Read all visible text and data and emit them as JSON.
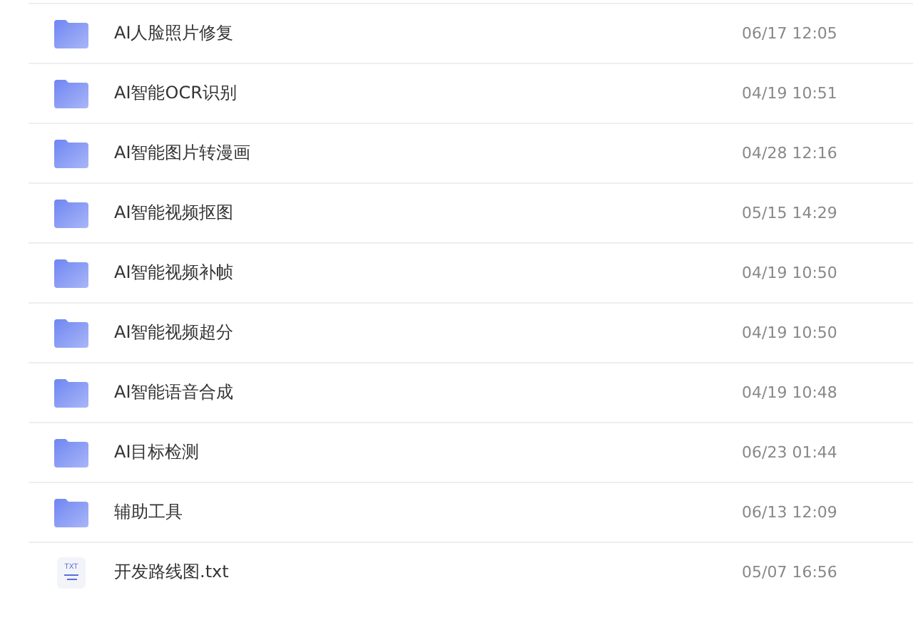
{
  "files": [
    {
      "kind": "folder",
      "name": "AI人脸照片修复",
      "modified": "06/17 12:05"
    },
    {
      "kind": "folder",
      "name": "AI智能OCR识别",
      "modified": "04/19 10:51"
    },
    {
      "kind": "folder",
      "name": "AI智能图片转漫画",
      "modified": "04/28 12:16"
    },
    {
      "kind": "folder",
      "name": "AI智能视频抠图",
      "modified": "05/15 14:29"
    },
    {
      "kind": "folder",
      "name": "AI智能视频补帧",
      "modified": "04/19 10:50"
    },
    {
      "kind": "folder",
      "name": "AI智能视频超分",
      "modified": "04/19 10:50"
    },
    {
      "kind": "folder",
      "name": "AI智能语音合成",
      "modified": "04/19 10:48"
    },
    {
      "kind": "folder",
      "name": "AI目标检测",
      "modified": "06/23 01:44"
    },
    {
      "kind": "folder",
      "name": "辅助工具",
      "modified": "06/13 12:09"
    },
    {
      "kind": "text-file",
      "name": "开发路线图.txt",
      "modified": "05/07 16:56",
      "icon_label": "TXT"
    }
  ]
}
